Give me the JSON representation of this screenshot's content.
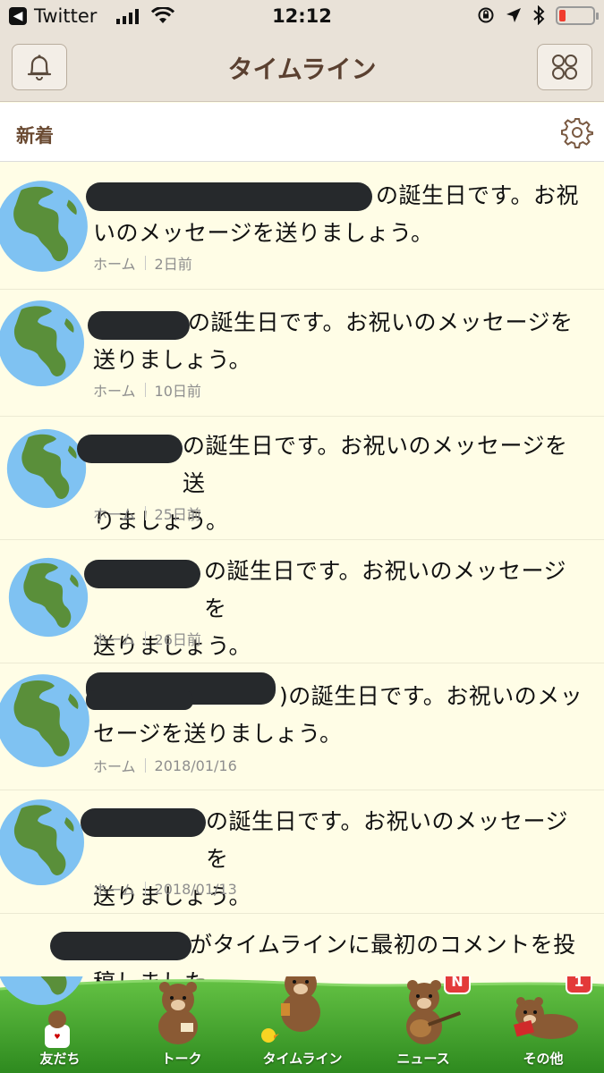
{
  "status_bar": {
    "back_app": "Twitter",
    "time": "12:12"
  },
  "header": {
    "title": "タイムライン"
  },
  "subheader": {
    "title": "新着"
  },
  "feed": [
    {
      "line1": "の誕生日です。お祝",
      "line2": "いのメッセージを送りましょう。",
      "source": "ホーム",
      "time": "2日前"
    },
    {
      "line1": "の誕生日です。お祝いのメッセージを",
      "line2": "送りましょう。",
      "source": "ホーム",
      "time": "10日前"
    },
    {
      "line1": "の誕生日です。お祝いのメッセージを送",
      "line2": "りましょう。",
      "source": "ホーム",
      "time": "25日前"
    },
    {
      "line1": "の誕生日です。お祝いのメッセージを",
      "line2": "送りましょう。",
      "source": "ホーム",
      "time": "26日前"
    },
    {
      "line1": ")の誕生日です。お祝いのメッ",
      "line2": "セージを送りましょう。",
      "source": "ホーム",
      "time": "2018/01/16"
    },
    {
      "line1": "の誕生日です。お祝いのメッセージを",
      "line2": "送りましょう。",
      "source": "ホーム",
      "time": "2018/01/13"
    },
    {
      "line1": "がタイムラインに最初のコメントを投",
      "line2": "稿しました。",
      "source": "",
      "time": ""
    }
  ],
  "tabs": [
    {
      "label": "友だち"
    },
    {
      "label": "トーク"
    },
    {
      "label": "タイムライン"
    },
    {
      "label": "ニュース",
      "badge": "N"
    },
    {
      "label": "その他",
      "badge": "1"
    }
  ],
  "colors": {
    "header_bg": "#e9e2d8",
    "title_brown": "#5a4030",
    "list_bg": "#fffde6",
    "badge_red": "#e33a3a",
    "grass_green": "#3f9a2c"
  }
}
